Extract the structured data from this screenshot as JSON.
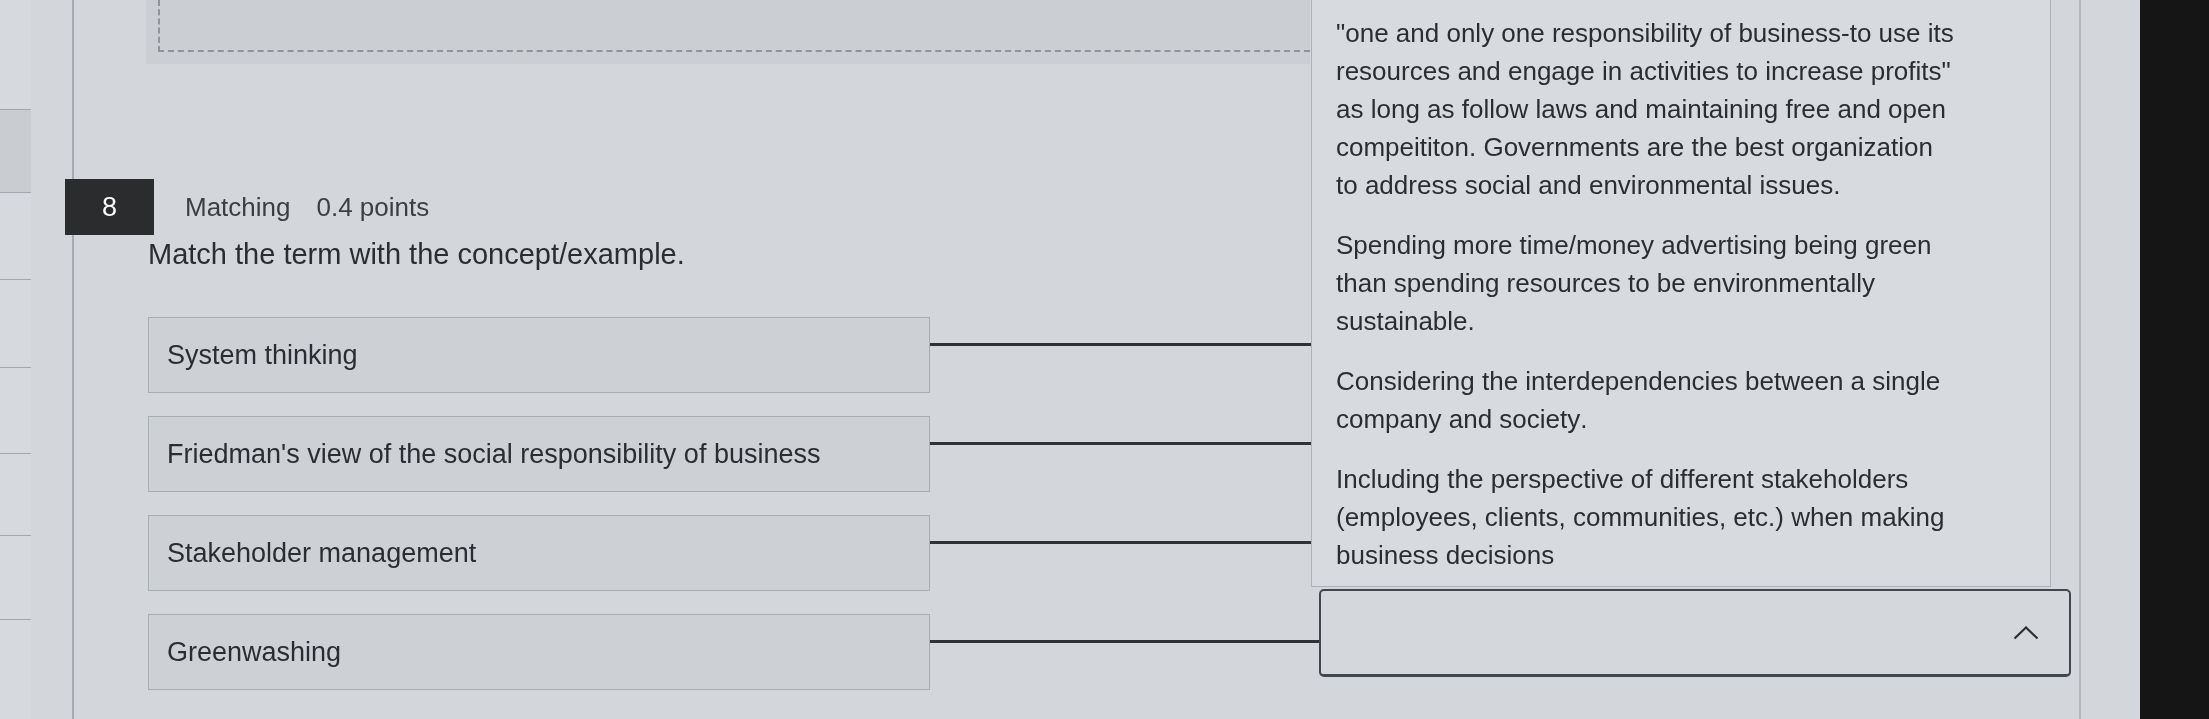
{
  "question": {
    "number": "8",
    "type": "Matching",
    "points": "0.4 points",
    "prompt": "Match the term with the concept/example."
  },
  "matches": [
    {
      "term": "System thinking"
    },
    {
      "term": "Friedman's view of the social responsibility of business"
    },
    {
      "term": "Stakeholder management"
    },
    {
      "term": "Greenwashing",
      "dropdown": {
        "expanded": true,
        "options": [
          {
            "text": "\"one and only one responsibility of business-to use its resources and engage in activities to increase profits\" as long as follow laws and maintaining free and open compeititon. Governments are the best organization to address social and environmental issues.",
            "selected": false
          },
          {
            "text": "Spending more time/money advertising being green than spending resources to be environmentally sustainable.",
            "selected": false
          },
          {
            "text": "Considering the interdependencies between a single company and society.",
            "selected": false
          },
          {
            "text": "Including the perspective of different stakeholders (employees, clients, communities, etc.) when making business decisions",
            "selected": false
          }
        ]
      }
    }
  ]
}
